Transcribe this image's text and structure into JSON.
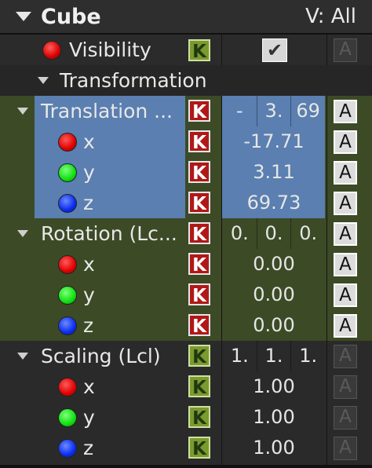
{
  "header": {
    "title": "Cube",
    "view_filter": "V: All"
  },
  "visibility": {
    "label": "Visibility",
    "key_label": "K",
    "checked_glyph": "✔",
    "anim_label": "A"
  },
  "transformation": {
    "label": "Transformation"
  },
  "translation": {
    "label": "Translation ...",
    "key_label": "K",
    "anim_label": "A",
    "summary": [
      "-",
      "3.",
      "69"
    ],
    "x": {
      "label": "x",
      "value": "-17.71"
    },
    "y": {
      "label": "y",
      "value": "3.11"
    },
    "z": {
      "label": "z",
      "value": "69.73"
    }
  },
  "rotation": {
    "label": "Rotation (Lc...",
    "key_label": "K",
    "anim_label": "A",
    "summary": [
      "0.",
      "0.",
      "0."
    ],
    "x": {
      "label": "x",
      "value": "0.00"
    },
    "y": {
      "label": "y",
      "value": "0.00"
    },
    "z": {
      "label": "z",
      "value": "0.00"
    }
  },
  "scaling": {
    "label": "Scaling (Lcl)",
    "key_label": "K",
    "anim_label": "A",
    "summary": [
      "1.",
      "1.",
      "1."
    ],
    "x": {
      "label": "x",
      "value": "1.00"
    },
    "y": {
      "label": "y",
      "value": "1.00"
    },
    "z": {
      "label": "z",
      "value": "1.00"
    }
  },
  "colors": {
    "selected_row": "#5a7fb0",
    "animated_group": "#3c4a26",
    "key_on": "#b01818",
    "key_off": "#7c9a2e"
  }
}
